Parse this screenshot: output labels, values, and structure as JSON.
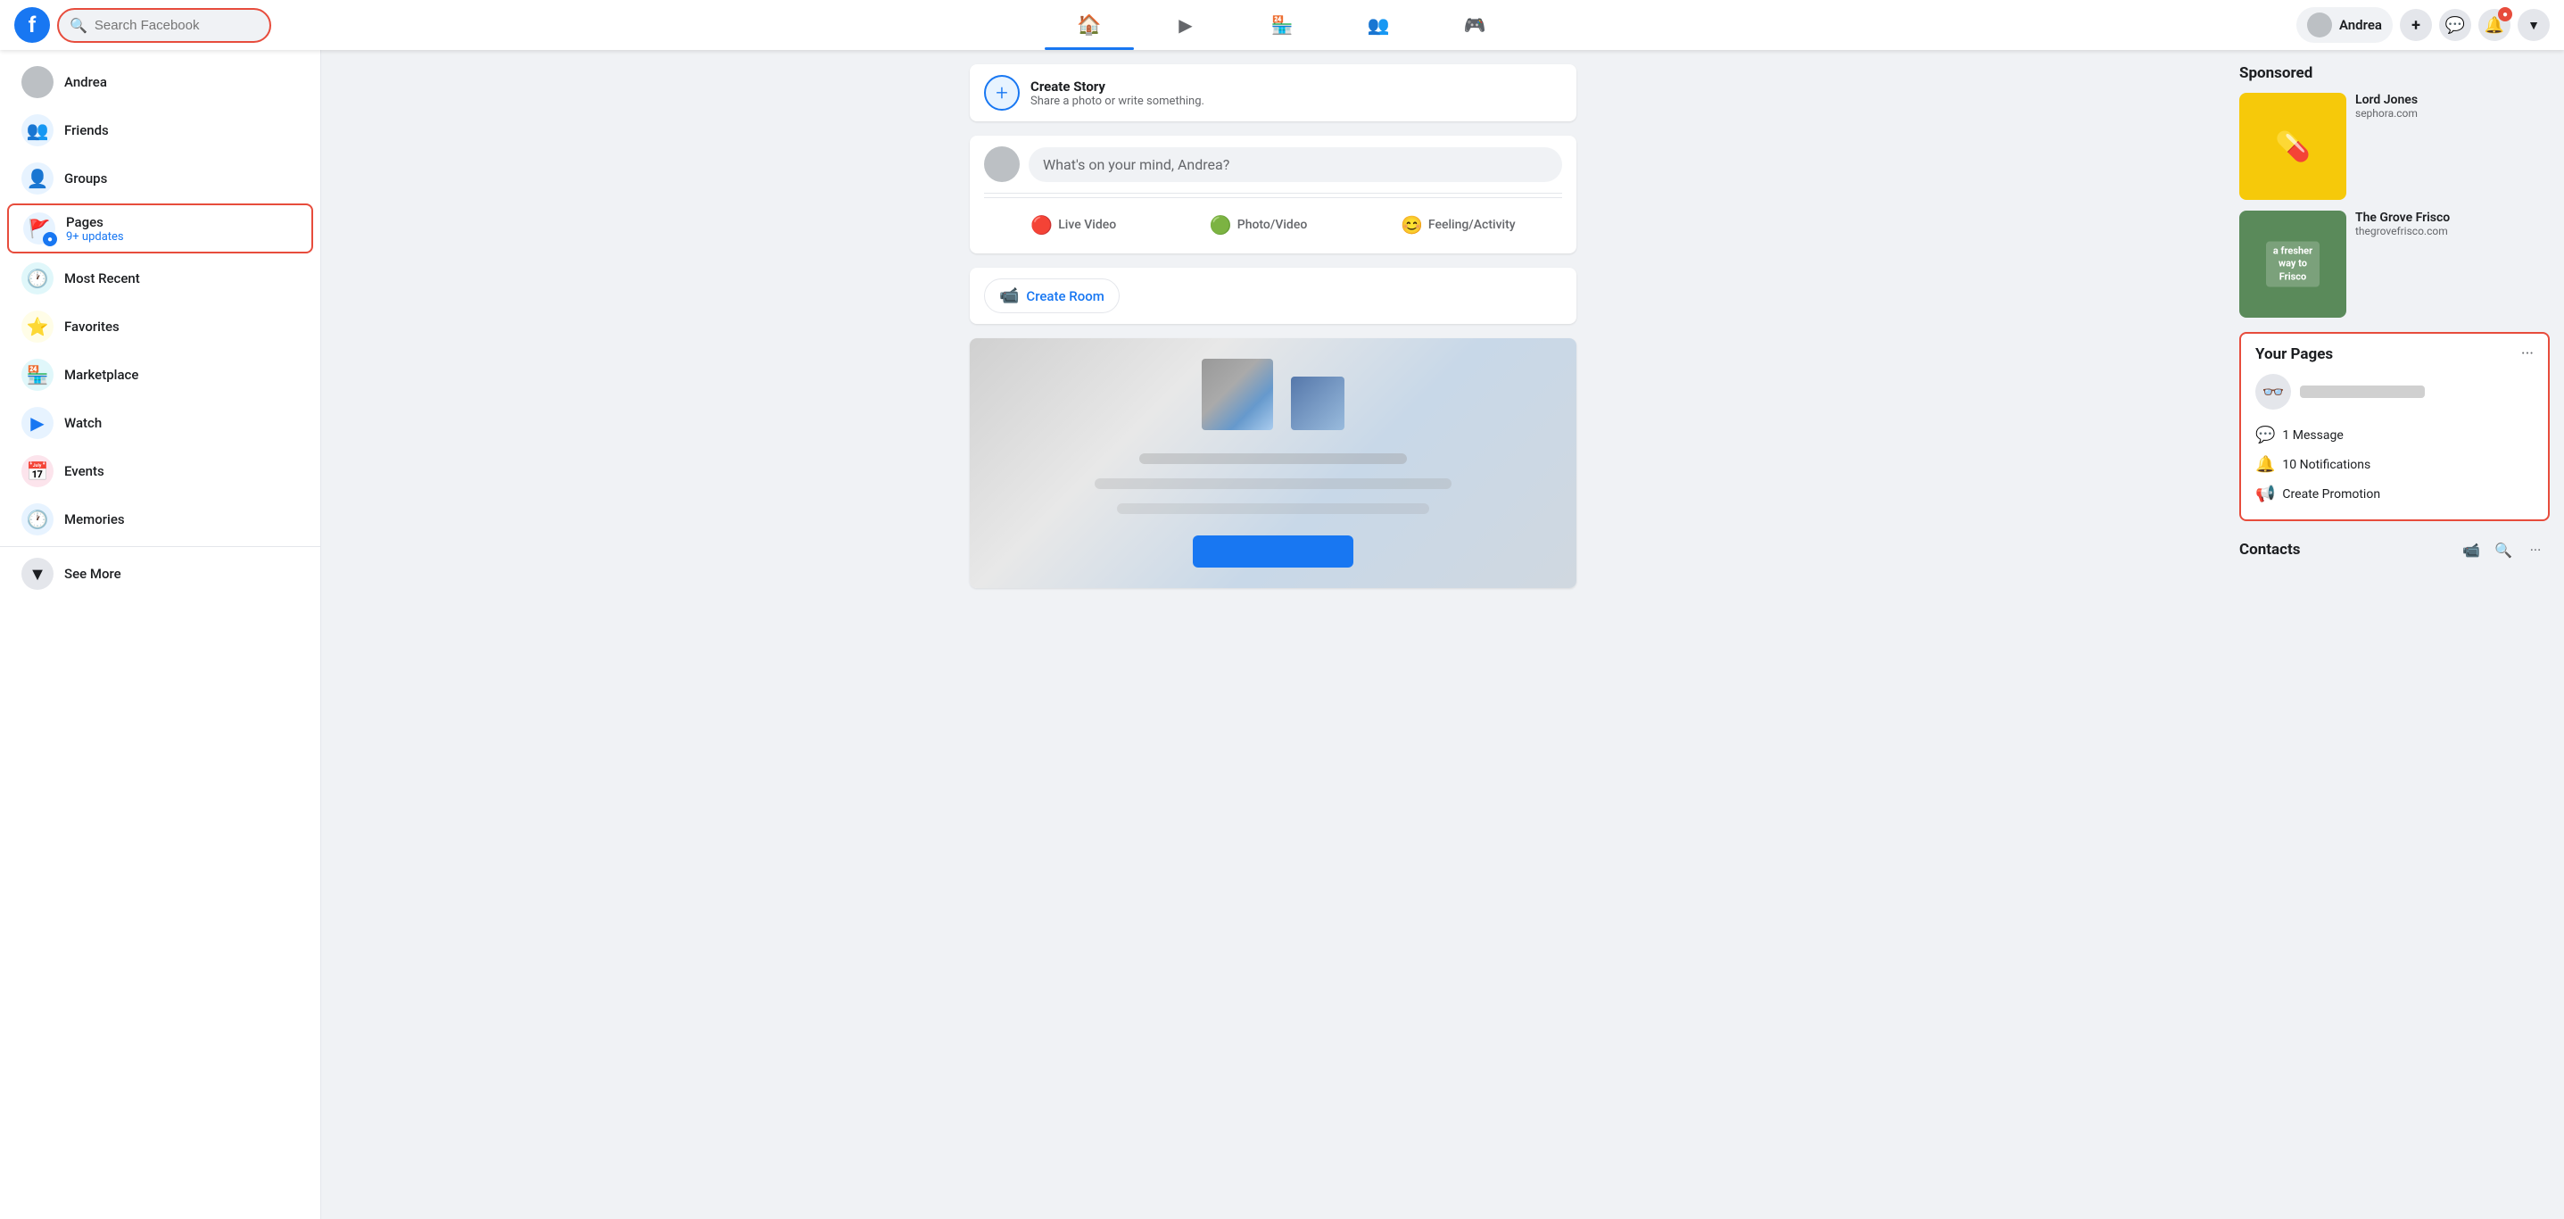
{
  "header": {
    "logo_letter": "f",
    "search_placeholder": "Search Facebook",
    "nav_items": [
      {
        "id": "home",
        "icon": "🏠",
        "label": "Home",
        "active": true
      },
      {
        "id": "video",
        "icon": "▶",
        "label": "Watch",
        "active": false
      },
      {
        "id": "marketplace",
        "icon": "🏪",
        "label": "Marketplace",
        "active": false
      },
      {
        "id": "groups",
        "icon": "👥",
        "label": "Groups",
        "active": false
      },
      {
        "id": "gaming",
        "icon": "🎮",
        "label": "Gaming",
        "active": false
      }
    ],
    "user_name": "Andrea",
    "plus_btn": "+",
    "messenger_icon": "💬",
    "notifications_icon": "🔔"
  },
  "sidebar": {
    "user_name": "Andrea",
    "items": [
      {
        "id": "friends",
        "label": "Friends",
        "icon": "👥"
      },
      {
        "id": "groups",
        "label": "Groups",
        "icon": "👤"
      },
      {
        "id": "pages",
        "label": "Pages",
        "icon": "🚩",
        "badge": "9+ updates",
        "highlighted": true
      },
      {
        "id": "most-recent",
        "label": "Most Recent",
        "icon": "🕐"
      },
      {
        "id": "favorites",
        "label": "Favorites",
        "icon": "⭐"
      },
      {
        "id": "marketplace",
        "label": "Marketplace",
        "icon": "🏪"
      },
      {
        "id": "watch",
        "label": "Watch",
        "icon": "▶"
      },
      {
        "id": "events",
        "label": "Events",
        "icon": "📅"
      },
      {
        "id": "memories",
        "label": "Memories",
        "icon": "🕐"
      },
      {
        "id": "see-more",
        "label": "See More",
        "icon": "▼"
      }
    ]
  },
  "feed": {
    "create_story": {
      "title": "Create Story",
      "subtitle": "Share a photo or write something."
    },
    "post_box": {
      "placeholder": "What's on your mind, Andrea?"
    },
    "post_actions": [
      {
        "id": "live-video",
        "label": "Live Video",
        "icon": "🔴"
      },
      {
        "id": "photo-video",
        "label": "Photo/Video",
        "icon": "🟢"
      },
      {
        "id": "feeling",
        "label": "Feeling/Activity",
        "icon": "😊"
      }
    ],
    "create_room": {
      "label": "Create Room"
    }
  },
  "right_sidebar": {
    "sponsored": {
      "title": "Sponsored",
      "ads": [
        {
          "id": "lord-jones",
          "title": "Lord Jones",
          "url": "sephora.com",
          "color": "#f6c90a"
        },
        {
          "id": "grove-frisco",
          "title": "The Grove Frisco",
          "url": "thegrovefrisco.com",
          "overlay_text": "a fresher way to Frisco",
          "color": "#6a9a6a"
        }
      ]
    },
    "your_pages": {
      "title": "Your Pages",
      "more_options": "···",
      "stats": [
        {
          "id": "messages",
          "icon": "💬",
          "label": "1 Message"
        },
        {
          "id": "notifications",
          "icon": "🔔",
          "label": "10 Notifications"
        },
        {
          "id": "create-promotion",
          "icon": "📢",
          "label": "Create Promotion"
        }
      ]
    },
    "contacts": {
      "title": "Contacts",
      "add_icon": "📹",
      "search_icon": "🔍",
      "more_icon": "···"
    }
  }
}
